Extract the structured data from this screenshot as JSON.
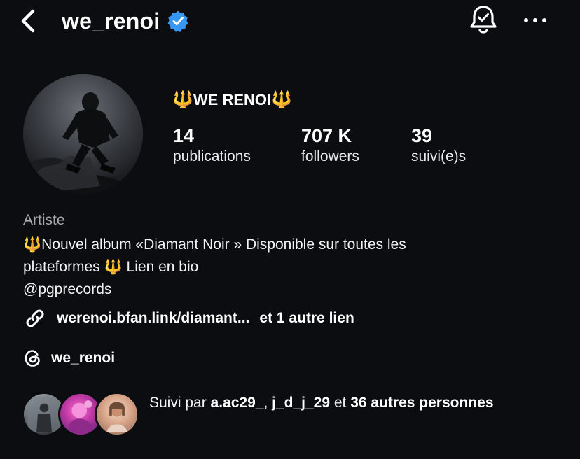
{
  "header": {
    "username": "we_renoi",
    "verified": true,
    "back_icon": "chevron-left-icon",
    "bell_icon": "bell-check-icon",
    "more_icon": "more-horizontal-icon"
  },
  "profile": {
    "display_name_prefix": "🔱",
    "display_name": "WE RENOI",
    "display_name_suffix": "🔱",
    "stats": {
      "posts_value": "14",
      "posts_label": "publications",
      "followers_value": "707 K",
      "followers_label": "followers",
      "following_value": "39",
      "following_label": "suivi(e)s"
    },
    "category": "Artiste",
    "bio": {
      "line1_prefix": "🔱",
      "line1_text": "Nouvel album «Diamant Noir » Disponible sur toutes les",
      "line2_text_a": "plateformes ",
      "line2_emoji": "🔱",
      "line2_text_b": " Lien en bio",
      "line3_text": "@pgprecords"
    },
    "link": {
      "url_text": "werenoi.bfan.link/diamant...",
      "extra_text": "et 1 autre lien"
    },
    "threads": {
      "handle": "we_renoi"
    }
  },
  "followed_by": {
    "prefix": "Suivi par ",
    "user1": "a.ac29_",
    "separator": ", ",
    "user2": "j_d_j_29",
    "middle": " et ",
    "others": "36 autres personnes"
  },
  "colors": {
    "background": "#0c0d10",
    "verified_blue": "#3897f0",
    "trident_gold": "#f2b51d",
    "muted_text": "#a8a8ad"
  }
}
